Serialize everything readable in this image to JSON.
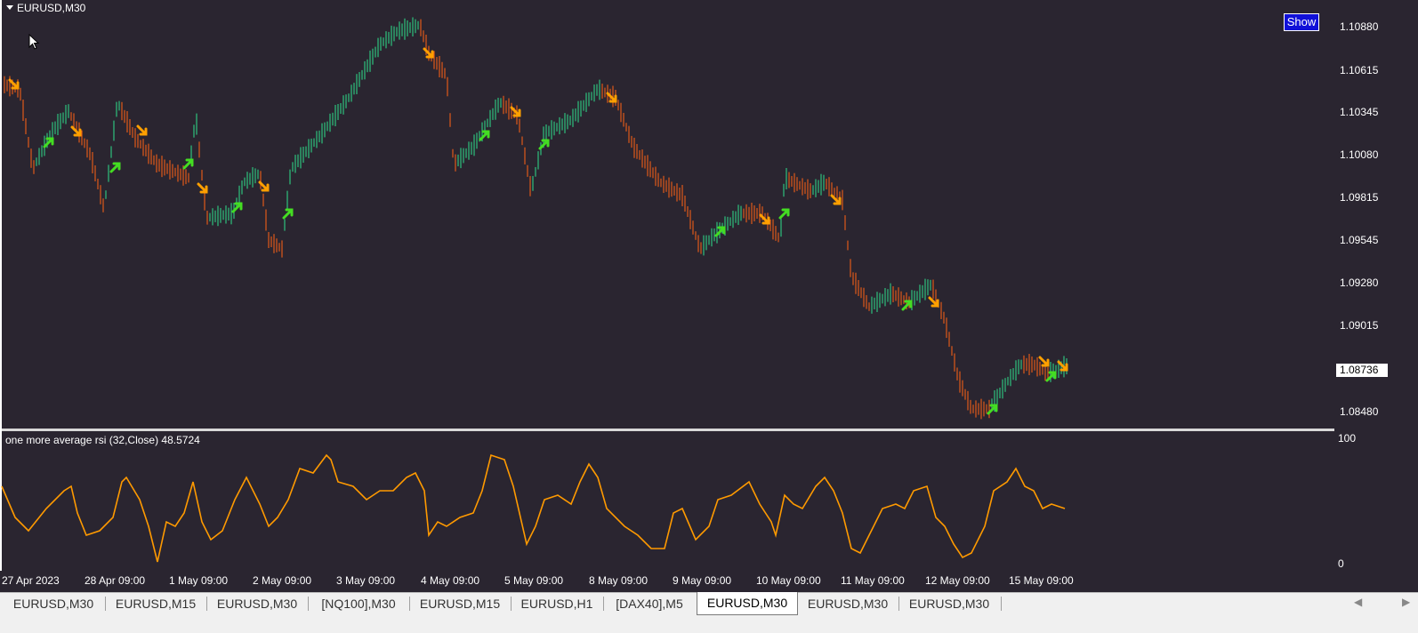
{
  "chart": {
    "symbol_title": "EURUSD,M30",
    "show_button": "Show",
    "indicator_label": "one more average rsi (32,Close) 48.5724",
    "price_levels": [
      "1.10880",
      "1.10615",
      "1.10345",
      "1.10080",
      "1.09815",
      "1.09545",
      "1.09280",
      "1.09015",
      "1.08480"
    ],
    "current_price": "1.08736",
    "indicator_scale": {
      "max": "100",
      "min": "0"
    },
    "time_labels": [
      "27 Apr 2023",
      "28 Apr 09:00",
      "1 May 09:00",
      "2 May 09:00",
      "3 May 09:00",
      "4 May 09:00",
      "5 May 09:00",
      "8 May 09:00",
      "9 May 09:00",
      "10 May 09:00",
      "11 May 09:00",
      "12 May 09:00",
      "15 May 09:00"
    ],
    "colors": {
      "background": "#2a2530",
      "bull_bar": "#2ec27e",
      "bear_bar": "#e05a1a",
      "bull_arrow": "#44dd22",
      "bear_arrow": "#ffa000",
      "indicator_line": "#ff9a00"
    }
  },
  "tabs": [
    {
      "label": "EURUSD,M30"
    },
    {
      "label": "EURUSD,M15"
    },
    {
      "label": "EURUSD,M30"
    },
    {
      "label": "[NQ100],M30"
    },
    {
      "label": "EURUSD,M15"
    },
    {
      "label": "EURUSD,H1"
    },
    {
      "label": "[DAX40],M5"
    },
    {
      "label": "EURUSD,M30",
      "active": true
    },
    {
      "label": "EURUSD,M30"
    },
    {
      "label": "EURUSD,M30"
    }
  ],
  "tab_nav": {
    "prev": "◀",
    "next": "▶"
  }
}
